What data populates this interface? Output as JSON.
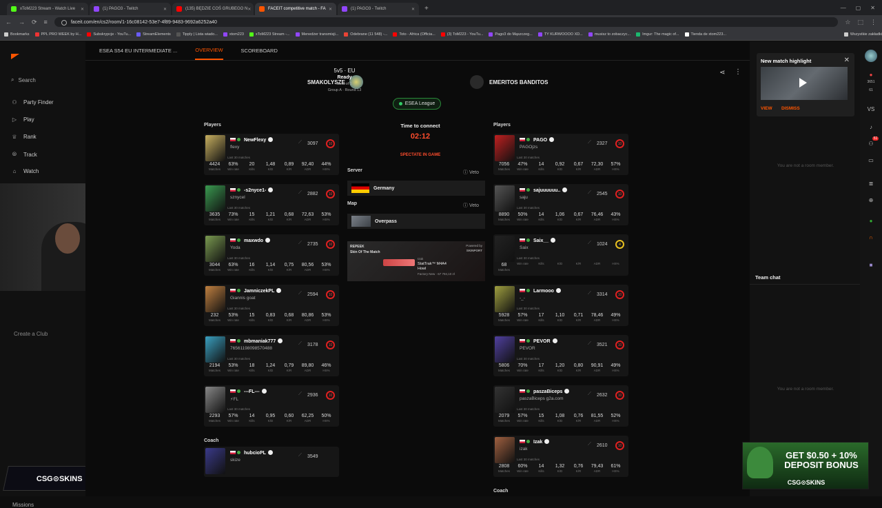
{
  "browser": {
    "tabs": [
      {
        "label": "xToM223 Stream - Watch Live",
        "color": "#53fc18"
      },
      {
        "label": "(1) PAGO3 - Twitch",
        "color": "#9146ff"
      },
      {
        "label": "(135) BĘDZIE COŚ GRUBEGO N",
        "color": "#ff0000"
      },
      {
        "label": "FACEIT competitive match - FA",
        "color": "#ff5500"
      },
      {
        "label": "(1) PAGO3 - Twitch",
        "color": "#9146ff"
      }
    ],
    "url": "faceit.com/en/cs2/room/1-16c08142-53e7-4f89-9483-9692a6252a40",
    "bookmarks": [
      {
        "label": "Bookmarks",
        "color": "#ccc"
      },
      {
        "label": "PPL PRO WEEK by H...",
        "color": "#e33"
      },
      {
        "label": "Subskrypcje - YouTu...",
        "color": "#f00"
      },
      {
        "label": "StreamElements",
        "color": "#6a5cff"
      },
      {
        "label": "Tipply | Lista wiado...",
        "color": "#555"
      },
      {
        "label": "xtom223",
        "color": "#9146ff"
      },
      {
        "label": "xToM223 Stream -...",
        "color": "#53fc18"
      },
      {
        "label": "Menedżer transmisji...",
        "color": "#9146ff"
      },
      {
        "label": "Odebrane (11 548) -...",
        "color": "#ea4335"
      },
      {
        "label": "Toto - Africa (Officia...",
        "color": "#f00"
      },
      {
        "label": "(3) ToM223 - YouTu...",
        "color": "#f00"
      },
      {
        "label": "Pago3 do Mąszczeg...",
        "color": "#9146ff"
      },
      {
        "label": "TY KURWOOOO XD...",
        "color": "#9146ff"
      },
      {
        "label": "musisz to zobaczyc...",
        "color": "#9146ff"
      },
      {
        "label": "Imgur: The magic of...",
        "color": "#1bb76e"
      },
      {
        "label": "Tienda de xtom223...",
        "color": "#fff"
      },
      {
        "label": "Wszystkie zakładki",
        "color": "#ccc"
      }
    ]
  },
  "nav": {
    "search": "Search",
    "items": [
      "Party Finder",
      "Play",
      "Rank",
      "Track",
      "Watch"
    ],
    "create_club": "Create a Club",
    "missions": "Missions",
    "sponsor": "CSG⊙SKINS"
  },
  "subtabs": {
    "match": "ESEA S54 EU INTERMEDIATE ...",
    "overview": "OVERVIEW",
    "scoreboard": "SCOREBOARD"
  },
  "header": {
    "team1": "SMAKOLYSZE",
    "team2": "EMERITOS BANDITOS",
    "format": "5v5 · EU",
    "status": "Ready",
    "best_of": "Best of 1",
    "group": "Group A · Round 13",
    "league": "ESEA League"
  },
  "center": {
    "time_label": "Time to connect",
    "countdown": "02:12",
    "spectate": "SPECTATE IN GAME",
    "server_label": "Server",
    "veto": "Veto",
    "server": "Germany",
    "map_label": "Map",
    "map": "Overpass",
    "sotm": {
      "title": "Skin Of The Match",
      "brand": "REPEEK",
      "powered": "Powered by",
      "partner": "SKINPORT",
      "owner": "Izak",
      "skin": "StatTrak™ M4A4",
      "skin2": "Howl",
      "grade": "Factory New · 67 794,10 zł"
    }
  },
  "stat_labels": {
    "matches": "Matches",
    "winrate": "Win rate",
    "kills": "Kills",
    "kd": "K/D",
    "kr": "K/R",
    "adr": "ADR",
    "hs": "HS%",
    "last": "Last 30 matches"
  },
  "players_label": "Players",
  "coach_label": "Coach",
  "team1_players": [
    {
      "nick": "NewFlexy",
      "sub": "flexy",
      "elo": "3097",
      "lvl": "10",
      "stats": [
        "4424",
        "63%",
        "20",
        "1,48",
        "0,89",
        "92,40",
        "44%"
      ],
      "color": "#c8b060"
    },
    {
      "nick": "-s2nyce1-",
      "sub": "sznycel",
      "elo": "2882",
      "lvl": "10",
      "stats": [
        "3635",
        "73%",
        "15",
        "1,21",
        "0,68",
        "72,63",
        "53%"
      ],
      "color": "#3a9a50"
    },
    {
      "nick": "maxwdo",
      "sub": "Yoda",
      "elo": "2735",
      "lvl": "10",
      "stats": [
        "3044",
        "63%",
        "16",
        "1,14",
        "0,75",
        "80,56",
        "53%"
      ],
      "color": "#7a9a50"
    },
    {
      "nick": "JamniczekPL",
      "sub": "Giannis goat",
      "elo": "2594",
      "lvl": "10",
      "stats": [
        "232",
        "53%",
        "15",
        "0,83",
        "0,68",
        "80,86",
        "53%"
      ],
      "color": "#c08040"
    },
    {
      "nick": "mbmaniak777",
      "sub": "76561198098570488",
      "elo": "3178",
      "lvl": "10",
      "stats": [
        "2194",
        "53%",
        "18",
        "1,24",
        "0,79",
        "89,80",
        "46%"
      ],
      "color": "#3aa0c0"
    },
    {
      "nick": "---FL---",
      "sub": "⚡FL",
      "elo": "2936",
      "lvl": "10",
      "stats": [
        "2293",
        "57%",
        "14",
        "0,95",
        "0,60",
        "62,25",
        "50%"
      ],
      "color": "#888"
    }
  ],
  "team1_coach": {
    "nick": "hubcioPL",
    "sub": "skize",
    "elo": "3549",
    "color": "#3a3a8a"
  },
  "team2_players": [
    {
      "nick": "PAGO",
      "sub": "PAGOjzs",
      "elo": "2327",
      "lvl": "10",
      "stats": [
        "7056",
        "47%",
        "14",
        "0,92",
        "0,67",
        "72,30",
        "57%"
      ],
      "color": "#c02020"
    },
    {
      "nick": "sajuuuuuu..",
      "sub": "saju",
      "elo": "2545",
      "lvl": "10",
      "stats": [
        "8890",
        "50%",
        "14",
        "1,06",
        "0,67",
        "76,46",
        "43%"
      ],
      "color": "#555"
    },
    {
      "nick": "Saix__",
      "sub": "Saix",
      "elo": "1024",
      "lvl": "4",
      "stats": [
        "68",
        "",
        "",
        "",
        "",
        "",
        ""
      ],
      "color": "#222"
    },
    {
      "nick": "Larmooo",
      "sub": "-_-",
      "elo": "3314",
      "lvl": "10",
      "stats": [
        "5928",
        "57%",
        "17",
        "1,10",
        "0,71",
        "78,46",
        "49%"
      ],
      "color": "#a0a040"
    },
    {
      "nick": "PEVOR",
      "sub": "PEVOR",
      "elo": "3521",
      "lvl": "10",
      "stats": [
        "5806",
        "70%",
        "17",
        "1,20",
        "0,80",
        "90,91",
        "49%"
      ],
      "color": "#5040a0"
    },
    {
      "nick": "paszaBiceps",
      "sub": "paszaBiceps g2a.com",
      "elo": "2632",
      "lvl": "10",
      "stats": [
        "2079",
        "57%",
        "15",
        "1,08",
        "0,76",
        "81,55",
        "52%"
      ],
      "color": "#333"
    },
    {
      "nick": "Izak",
      "sub": "izak",
      "elo": "2610",
      "lvl": "10",
      "stats": [
        "2808",
        "60%",
        "14",
        "1,32",
        "0,76",
        "79,43",
        "61%"
      ],
      "color": "#a06040"
    }
  ],
  "right_panel": {
    "notif_title": "New match highlight",
    "view": "VIEW",
    "dismiss": "DISMISS",
    "not_member": "You are not a room member.",
    "team_chat": "Team chat",
    "counter": "3651",
    "counter2": "61",
    "vs": "VS",
    "badge": "51"
  },
  "promo": {
    "text": "GET $0.50 + 10% DEPOSIT BONUS",
    "logo": "CSG⊙SKINS"
  }
}
